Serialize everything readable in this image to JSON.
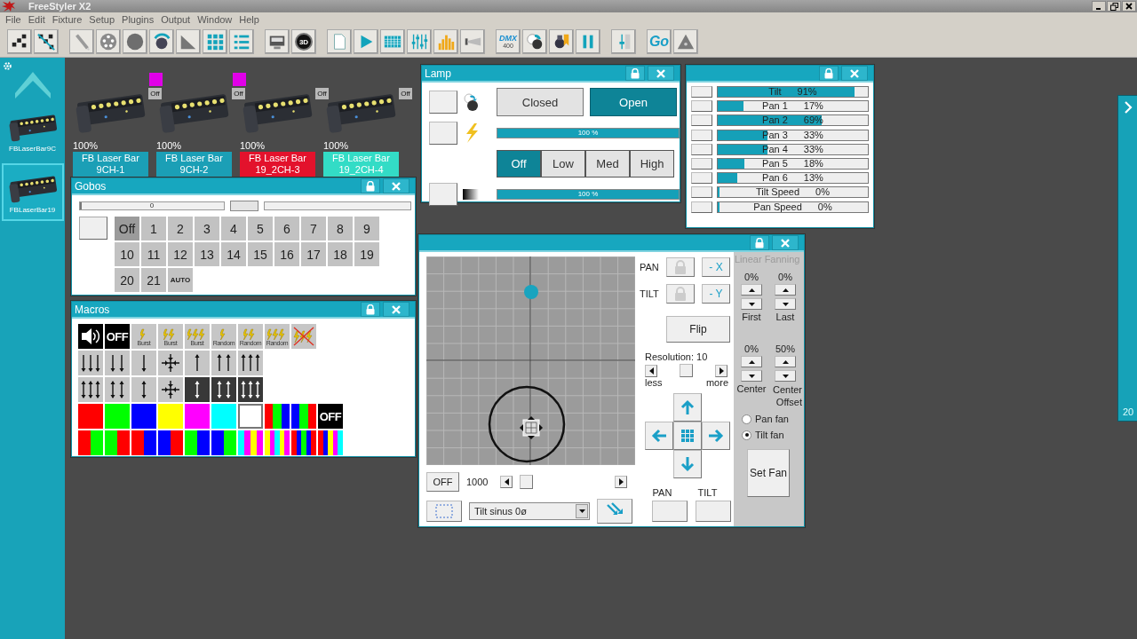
{
  "window": {
    "title": "FreeStyler X2"
  },
  "menu": [
    "File",
    "Edit",
    "Fixture",
    "Setup",
    "Plugins",
    "Output",
    "Window",
    "Help"
  ],
  "toolbar": {
    "view3d_label": "3D",
    "dmx_label": "DMX",
    "dmx_sublabel": "400",
    "go_label": "Go"
  },
  "sidebar": {
    "items": [
      {
        "label": "FBLaserBar9C",
        "selected": false
      },
      {
        "label": "FBLaserBar19",
        "selected": true
      }
    ]
  },
  "fixtures": [
    {
      "intensity": "100%",
      "name": "FB Laser Bar 9CH-1",
      "badge": "Off",
      "marked": true,
      "color": "#1b9fb6"
    },
    {
      "intensity": "100%",
      "name": "FB Laser Bar 9CH-2",
      "badge": "Off",
      "marked": true,
      "color": "#1b9fb6"
    },
    {
      "intensity": "100%",
      "name": "FB Laser Bar 19_2CH-3",
      "badge": "Off",
      "marked": false,
      "color": "#e3122c"
    },
    {
      "intensity": "100%",
      "name": "FB Laser Bar 19_2CH-4",
      "badge": "Off",
      "marked": false,
      "color": "#33dcc6"
    }
  ],
  "gobos": {
    "title": "Gobos",
    "slider": {
      "reading": "0",
      "level": 0
    },
    "buttons": [
      {
        "label": "Off",
        "selected": true
      },
      {
        "label": "1",
        "selected": false
      },
      {
        "label": "2",
        "selected": false
      },
      {
        "label": "3",
        "selected": false
      },
      {
        "label": "4",
        "selected": false
      },
      {
        "label": "5",
        "selected": false
      },
      {
        "label": "6",
        "selected": false
      },
      {
        "label": "7",
        "selected": false
      },
      {
        "label": "8",
        "selected": false
      },
      {
        "label": "9",
        "selected": false
      },
      {
        "label": "10",
        "selected": false
      },
      {
        "label": "11",
        "selected": false
      },
      {
        "label": "12",
        "selected": false
      },
      {
        "label": "13",
        "selected": false
      },
      {
        "label": "14",
        "selected": false
      },
      {
        "label": "15",
        "selected": false
      },
      {
        "label": "16",
        "selected": false
      },
      {
        "label": "17",
        "selected": false
      },
      {
        "label": "18",
        "selected": false
      },
      {
        "label": "19",
        "selected": false
      },
      {
        "label": "20",
        "selected": false
      },
      {
        "label": "21",
        "selected": false
      },
      {
        "label": "AUTO",
        "selected": false
      }
    ]
  },
  "macros": {
    "title": "Macros",
    "rows": [
      [
        {
          "kind": "sound"
        },
        {
          "kind": "off",
          "label": "OFF"
        },
        {
          "kind": "flash1",
          "label": "Burst"
        },
        {
          "kind": "flash2",
          "label": "Burst"
        },
        {
          "kind": "flash3",
          "label": "Burst"
        },
        {
          "kind": "flash1",
          "label": "Random"
        },
        {
          "kind": "flash2",
          "label": "Random"
        },
        {
          "kind": "flash3",
          "label": "Random"
        },
        {
          "kind": "noflash"
        }
      ],
      [
        {
          "kind": "down3",
          "active": false
        },
        {
          "kind": "down2",
          "active": false
        },
        {
          "kind": "down1",
          "active": false
        },
        {
          "kind": "center",
          "active": false
        },
        {
          "kind": "up1",
          "active": false
        },
        {
          "kind": "up2",
          "active": false
        },
        {
          "kind": "up3",
          "active": false
        }
      ],
      [
        {
          "kind": "both3",
          "active": false
        },
        {
          "kind": "both2",
          "active": false
        },
        {
          "kind": "both1",
          "active": false
        },
        {
          "kind": "center",
          "active": false
        },
        {
          "kind": "both1",
          "active": true
        },
        {
          "kind": "both2",
          "active": true
        },
        {
          "kind": "both3",
          "active": true
        }
      ],
      [
        {
          "kind": "color",
          "color": "#ff0000"
        },
        {
          "kind": "color",
          "color": "#00ff00"
        },
        {
          "kind": "color",
          "color": "#0000ff"
        },
        {
          "kind": "color",
          "color": "#ffff00"
        },
        {
          "kind": "color",
          "color": "#ff00ff"
        },
        {
          "kind": "color",
          "color": "#00ffff"
        },
        {
          "kind": "color",
          "color": "#ffffff"
        },
        {
          "kind": "stripes",
          "stripes": [
            {
              "color": "#ff0000"
            },
            {
              "color": "#00ff00"
            },
            {
              "color": "#0000ff"
            }
          ]
        },
        {
          "kind": "stripes",
          "stripes": [
            {
              "color": "#0000ff"
            },
            {
              "color": "#00ff00"
            },
            {
              "color": "#ff0000"
            }
          ]
        },
        {
          "kind": "off",
          "label": "OFF"
        }
      ],
      [
        {
          "kind": "stripes",
          "stripes": [
            {
              "color": "#ff0000"
            },
            {
              "color": "#00ff00"
            }
          ]
        },
        {
          "kind": "stripes",
          "stripes": [
            {
              "color": "#00ff00"
            },
            {
              "color": "#ff0000"
            }
          ]
        },
        {
          "kind": "stripes",
          "stripes": [
            {
              "color": "#ff0000"
            },
            {
              "color": "#0000ff"
            }
          ]
        },
        {
          "kind": "stripes",
          "stripes": [
            {
              "color": "#0000ff"
            },
            {
              "color": "#ff0000"
            }
          ]
        },
        {
          "kind": "stripes",
          "stripes": [
            {
              "color": "#00ff00"
            },
            {
              "color": "#0000ff"
            }
          ]
        },
        {
          "kind": "stripes",
          "stripes": [
            {
              "color": "#0000ff"
            },
            {
              "color": "#00ff00"
            }
          ]
        },
        {
          "kind": "stripes",
          "stripes": [
            {
              "color": "#00ffff"
            },
            {
              "color": "#ff00ff"
            },
            {
              "color": "#ffff00"
            },
            {
              "color": "#ff00ff"
            }
          ]
        },
        {
          "kind": "stripes",
          "stripes": [
            {
              "color": "#ffff00"
            },
            {
              "color": "#ff00ff"
            },
            {
              "color": "#00ffff"
            },
            {
              "color": "#ffff00"
            },
            {
              "color": "#ff00ff"
            }
          ]
        },
        {
          "kind": "stripes",
          "stripes": [
            {
              "color": "#ff0000"
            },
            {
              "color": "#0000ff"
            },
            {
              "color": "#00ff00"
            },
            {
              "color": "#0000ff"
            },
            {
              "color": "#ff0000"
            }
          ]
        },
        {
          "kind": "stripes",
          "stripes": [
            {
              "color": "#ff0000"
            },
            {
              "color": "#0000ff"
            },
            {
              "color": "#ffff00"
            },
            {
              "color": "#ff00ff"
            },
            {
              "color": "#00ffff"
            }
          ]
        }
      ]
    ]
  },
  "lamp": {
    "title": "Lamp",
    "shutter": [
      {
        "label": "Closed",
        "selected": false
      },
      {
        "label": "Open",
        "selected": true
      }
    ],
    "dimmer": {
      "level": 1,
      "reading": "100 %"
    },
    "strobe": [
      {
        "label": "Off",
        "selected": true
      },
      {
        "label": "Low",
        "selected": false
      },
      {
        "label": "Med",
        "selected": false
      },
      {
        "label": "High",
        "selected": false
      }
    ],
    "fade": {
      "level": 1,
      "reading": "100 %"
    }
  },
  "channels": [
    {
      "label": "Tilt",
      "reading": "91%",
      "level": 0.91
    },
    {
      "label": "Pan 1",
      "reading": "17%",
      "level": 0.17
    },
    {
      "label": "Pan 2",
      "reading": "69%",
      "level": 0.69
    },
    {
      "label": "Pan 3",
      "reading": "33%",
      "level": 0.33
    },
    {
      "label": "Pan 4",
      "reading": "33%",
      "level": 0.33
    },
    {
      "label": "Pan 5",
      "reading": "18%",
      "level": 0.18
    },
    {
      "label": "Pan 6",
      "reading": "13%",
      "level": 0.13
    },
    {
      "label": "Tilt Speed",
      "reading": "0%",
      "level": 0
    },
    {
      "label": "Pan Speed",
      "reading": "0%",
      "level": 0
    }
  ],
  "position": {
    "pan_label": "PAN",
    "tilt_label": "TILT",
    "invert_x": "- X",
    "invert_y": "- Y",
    "flip": "Flip",
    "resolution": "Resolution: 10",
    "less": "less",
    "more": "more",
    "off": "OFF",
    "speed": "1000",
    "pattern": "Tilt sinus 0ø",
    "pan_button_label": "PAN",
    "tilt_button_label": "TILT",
    "fanning": {
      "title": "Linear Fanning",
      "values": [
        "0%",
        "0%",
        "0%",
        "50%"
      ],
      "labels": [
        "First",
        "Last",
        "Center",
        "Center Offset"
      ],
      "radios": [
        {
          "label": "Pan fan",
          "selected": false
        },
        {
          "label": "Tilt fan",
          "selected": true
        }
      ],
      "set_button": "Set Fan"
    }
  },
  "side_panel": {
    "count": "20"
  }
}
